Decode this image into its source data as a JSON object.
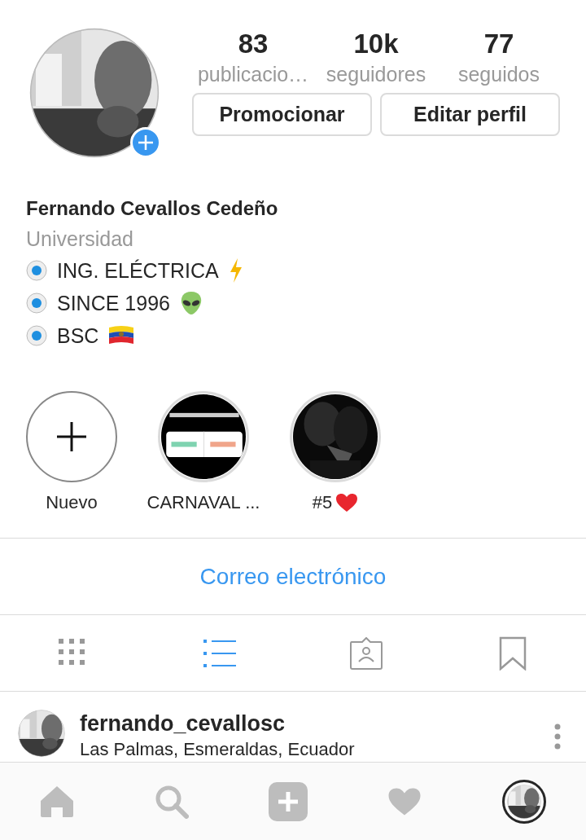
{
  "profile": {
    "stats": [
      {
        "value": "83",
        "label": "publicacio…"
      },
      {
        "value": "10k",
        "label": "seguidores"
      },
      {
        "value": "77",
        "label": "seguidos"
      }
    ],
    "buttons": [
      "Promocionar",
      "Editar perfil"
    ],
    "name": "Fernando Cevallos Cedeño",
    "category": "Universidad",
    "bio_lines": [
      "ING. ELÉCTRICA",
      "SINCE 1996",
      "BSC"
    ]
  },
  "highlights": [
    {
      "kind": "new",
      "label": "Nuevo"
    },
    {
      "kind": "picture",
      "label": "CARNAVAL ..."
    },
    {
      "kind": "picture",
      "label": "#5"
    }
  ],
  "contact_button": "Correo electrónico",
  "tabs": [
    {
      "kind": "grid",
      "selected": false
    },
    {
      "kind": "list",
      "selected": true
    },
    {
      "kind": "tagged",
      "selected": false
    },
    {
      "kind": "saved",
      "selected": false
    }
  ],
  "post": {
    "username": "fernando_cevallosc",
    "location": "Las Palmas, Esmeraldas, Ecuador"
  },
  "nav": [
    {
      "kind": "home",
      "selected": false
    },
    {
      "kind": "search",
      "selected": false
    },
    {
      "kind": "add",
      "selected": false
    },
    {
      "kind": "activity",
      "selected": false
    },
    {
      "kind": "profile",
      "selected": true
    }
  ]
}
